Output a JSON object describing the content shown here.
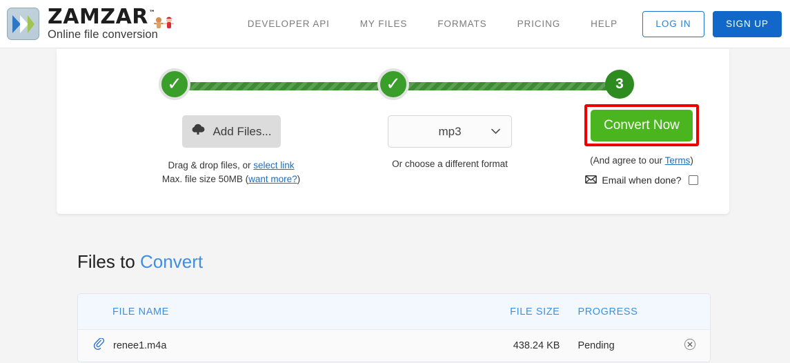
{
  "header": {
    "logo": {
      "word": "ZAMZAR",
      "tm": "™",
      "tagline": "Online file conversion"
    },
    "nav": [
      {
        "label": "DEVELOPER API"
      },
      {
        "label": "MY FILES"
      },
      {
        "label": "FORMATS"
      },
      {
        "label": "PRICING"
      },
      {
        "label": "HELP"
      }
    ],
    "login_label": "LOG IN",
    "signup_label": "SIGN UP"
  },
  "converter": {
    "steps": [
      {
        "state": "done",
        "label": "✓"
      },
      {
        "state": "done",
        "label": "✓"
      },
      {
        "state": "current",
        "label": "3"
      }
    ],
    "step1": {
      "button_label": "Add Files...",
      "drag_text_prefix": "Drag & drop files, or ",
      "drag_link": "select link",
      "size_text_prefix": "Max. file size 50MB (",
      "size_link": "want more?",
      "size_text_suffix": ")"
    },
    "step2": {
      "selected_format": "mp3",
      "options": [
        "mp3"
      ],
      "note": "Or choose a different format"
    },
    "step3": {
      "button_label": "Convert Now",
      "terms_prefix": "(And agree to our ",
      "terms_link": "Terms",
      "terms_suffix": ")",
      "email_label": "Email when done?",
      "email_checked": false
    },
    "highlight_color": "#ef0000"
  },
  "files_section": {
    "heading_static": "Files to ",
    "heading_accent": "Convert",
    "columns": {
      "name": "FILE NAME",
      "size": "FILE SIZE",
      "progress": "PROGRESS"
    },
    "rows": [
      {
        "name": "renee1.m4a",
        "size": "438.24 KB",
        "progress": "Pending"
      }
    ]
  },
  "colors": {
    "brand_blue": "#3f8fe0",
    "signup_blue": "#1268c9",
    "step_green": "#3a9e2b",
    "convert_green": "#4bb520",
    "highlight_red": "#ef0000"
  }
}
